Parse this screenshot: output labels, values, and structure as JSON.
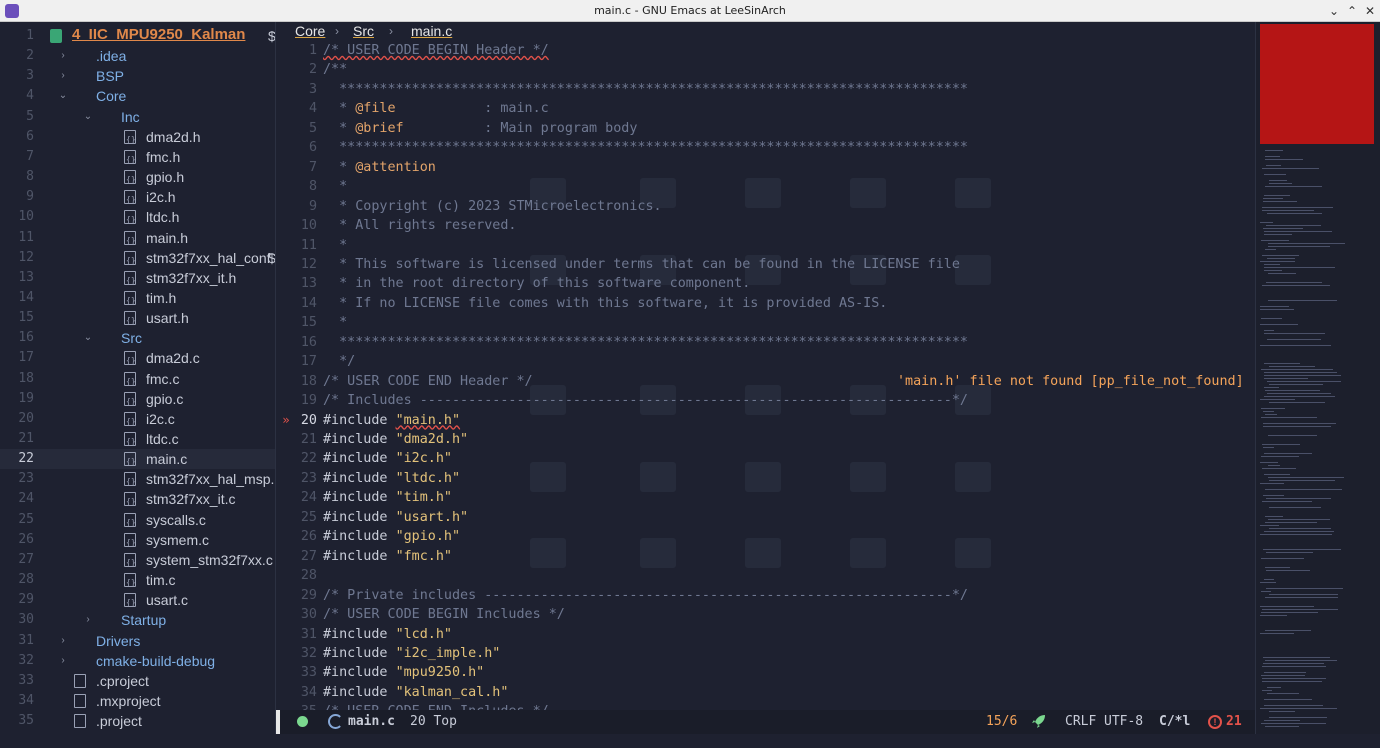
{
  "window": {
    "title": "main.c - GNU Emacs at LeeSinArch",
    "controls": [
      "⌄",
      "⌃",
      "✕"
    ]
  },
  "sidebar": {
    "current_line": 22,
    "rows": [
      {
        "n": 1,
        "depth": 0,
        "kind": "root",
        "label": "4_IIC_MPU9250_Kalman",
        "arrow": "",
        "trunc": "$"
      },
      {
        "n": 2,
        "depth": 1,
        "kind": "dir",
        "label": ".idea",
        "arrow": "›"
      },
      {
        "n": 3,
        "depth": 1,
        "kind": "dir",
        "label": "BSP",
        "arrow": "›"
      },
      {
        "n": 4,
        "depth": 1,
        "kind": "dir",
        "label": "Core",
        "arrow": "⌄"
      },
      {
        "n": 5,
        "depth": 2,
        "kind": "dir",
        "label": "Inc",
        "arrow": "⌄"
      },
      {
        "n": 6,
        "depth": 3,
        "kind": "file",
        "label": "dma2d.h"
      },
      {
        "n": 7,
        "depth": 3,
        "kind": "file",
        "label": "fmc.h"
      },
      {
        "n": 8,
        "depth": 3,
        "kind": "file",
        "label": "gpio.h"
      },
      {
        "n": 9,
        "depth": 3,
        "kind": "file",
        "label": "i2c.h"
      },
      {
        "n": 10,
        "depth": 3,
        "kind": "file",
        "label": "ltdc.h"
      },
      {
        "n": 11,
        "depth": 3,
        "kind": "file",
        "label": "main.h"
      },
      {
        "n": 12,
        "depth": 3,
        "kind": "file",
        "label": "stm32f7xx_hal_conf.",
        "trunc": "$"
      },
      {
        "n": 13,
        "depth": 3,
        "kind": "file",
        "label": "stm32f7xx_it.h"
      },
      {
        "n": 14,
        "depth": 3,
        "kind": "file",
        "label": "tim.h"
      },
      {
        "n": 15,
        "depth": 3,
        "kind": "file",
        "label": "usart.h"
      },
      {
        "n": 16,
        "depth": 2,
        "kind": "dir",
        "label": "Src",
        "arrow": "⌄"
      },
      {
        "n": 17,
        "depth": 3,
        "kind": "file",
        "label": "dma2d.c"
      },
      {
        "n": 18,
        "depth": 3,
        "kind": "file",
        "label": "fmc.c"
      },
      {
        "n": 19,
        "depth": 3,
        "kind": "file",
        "label": "gpio.c"
      },
      {
        "n": 20,
        "depth": 3,
        "kind": "file",
        "label": "i2c.c"
      },
      {
        "n": 21,
        "depth": 3,
        "kind": "file",
        "label": "ltdc.c"
      },
      {
        "n": 22,
        "depth": 3,
        "kind": "file",
        "label": "main.c"
      },
      {
        "n": 23,
        "depth": 3,
        "kind": "file",
        "label": "stm32f7xx_hal_msp.c"
      },
      {
        "n": 24,
        "depth": 3,
        "kind": "file",
        "label": "stm32f7xx_it.c"
      },
      {
        "n": 25,
        "depth": 3,
        "kind": "file",
        "label": "syscalls.c"
      },
      {
        "n": 26,
        "depth": 3,
        "kind": "file",
        "label": "sysmem.c"
      },
      {
        "n": 27,
        "depth": 3,
        "kind": "file",
        "label": "system_stm32f7xx.c"
      },
      {
        "n": 28,
        "depth": 3,
        "kind": "file",
        "label": "tim.c"
      },
      {
        "n": 29,
        "depth": 3,
        "kind": "file",
        "label": "usart.c"
      },
      {
        "n": 30,
        "depth": 2,
        "kind": "dir",
        "label": "Startup",
        "arrow": "›"
      },
      {
        "n": 31,
        "depth": 1,
        "kind": "dir",
        "label": "Drivers",
        "arrow": "›"
      },
      {
        "n": 32,
        "depth": 1,
        "kind": "dir",
        "label": "cmake-build-debug",
        "arrow": "›"
      },
      {
        "n": 33,
        "depth": 1,
        "kind": "doc",
        "label": ".cproject"
      },
      {
        "n": 34,
        "depth": 1,
        "kind": "doc",
        "label": ".mxproject"
      },
      {
        "n": 35,
        "depth": 1,
        "kind": "doc",
        "label": ".project"
      }
    ]
  },
  "breadcrumb": {
    "items": [
      "Core",
      "Src",
      "main.c"
    ],
    "separator": "›"
  },
  "editor": {
    "current_line": 20,
    "diagnostic": {
      "line": 18,
      "text": "'main.h' file not found [pp_file_not_found]"
    },
    "lines": [
      {
        "n": 1,
        "t": "c",
        "text": "/* USER CODE BEGIN Header */"
      },
      {
        "n": 2,
        "t": "c",
        "text": "/**"
      },
      {
        "n": 3,
        "t": "c",
        "text": "  ******************************************************************************"
      },
      {
        "n": 4,
        "t": "d",
        "tag": "@file",
        "text": "           : main.c"
      },
      {
        "n": 5,
        "t": "d",
        "tag": "@brief",
        "text": "          : Main program body"
      },
      {
        "n": 6,
        "t": "c",
        "text": "  ******************************************************************************"
      },
      {
        "n": 7,
        "t": "d",
        "tag": "@attention",
        "text": ""
      },
      {
        "n": 8,
        "t": "c",
        "text": "  *"
      },
      {
        "n": 9,
        "t": "c",
        "text": "  * Copyright (c) 2023 STMicroelectronics."
      },
      {
        "n": 10,
        "t": "c",
        "text": "  * All rights reserved."
      },
      {
        "n": 11,
        "t": "c",
        "text": "  *"
      },
      {
        "n": 12,
        "t": "c",
        "text": "  * This software is licensed under terms that can be found in the LICENSE file"
      },
      {
        "n": 13,
        "t": "c",
        "text": "  * in the root directory of this software component."
      },
      {
        "n": 14,
        "t": "c",
        "text": "  * If no LICENSE file comes with this software, it is provided AS-IS."
      },
      {
        "n": 15,
        "t": "c",
        "text": "  *"
      },
      {
        "n": 16,
        "t": "c",
        "text": "  ******************************************************************************"
      },
      {
        "n": 17,
        "t": "c",
        "text": "  */"
      },
      {
        "n": 18,
        "t": "c",
        "text": "/* USER CODE END Header */"
      },
      {
        "n": 19,
        "t": "c",
        "text": "/* Includes ------------------------------------------------------------------*/"
      },
      {
        "n": 20,
        "t": "i",
        "text": "\"main.h\"",
        "err": true
      },
      {
        "n": 21,
        "t": "i",
        "text": "\"dma2d.h\""
      },
      {
        "n": 22,
        "t": "i",
        "text": "\"i2c.h\""
      },
      {
        "n": 23,
        "t": "i",
        "text": "\"ltdc.h\""
      },
      {
        "n": 24,
        "t": "i",
        "text": "\"tim.h\""
      },
      {
        "n": 25,
        "t": "i",
        "text": "\"usart.h\""
      },
      {
        "n": 26,
        "t": "i",
        "text": "\"gpio.h\""
      },
      {
        "n": 27,
        "t": "i",
        "text": "\"fmc.h\""
      },
      {
        "n": 28,
        "t": "c",
        "text": ""
      },
      {
        "n": 29,
        "t": "c",
        "text": "/* Private includes ----------------------------------------------------------*/"
      },
      {
        "n": 30,
        "t": "c",
        "text": "/* USER CODE BEGIN Includes */"
      },
      {
        "n": 31,
        "t": "i",
        "text": "\"lcd.h\""
      },
      {
        "n": 32,
        "t": "i",
        "text": "\"i2c_imple.h\""
      },
      {
        "n": 33,
        "t": "i",
        "text": "\"mpu9250.h\""
      },
      {
        "n": 34,
        "t": "i",
        "text": "\"kalman_cal.h\""
      },
      {
        "n": 35,
        "t": "c",
        "text": "/* USER CODE END Includes */"
      }
    ],
    "include_kw": "#include "
  },
  "modeline": {
    "buffer": "main.c",
    "position": "20 Top",
    "column": "15/6",
    "eol": "CRLF",
    "encoding": "UTF-8",
    "mode": "C/*l",
    "errors": "21",
    "error_mark": "!"
  },
  "colors": {
    "accent": "#e0884a",
    "error": "#e3524a",
    "string": "#e3c27a",
    "ok": "#7bd88f"
  }
}
